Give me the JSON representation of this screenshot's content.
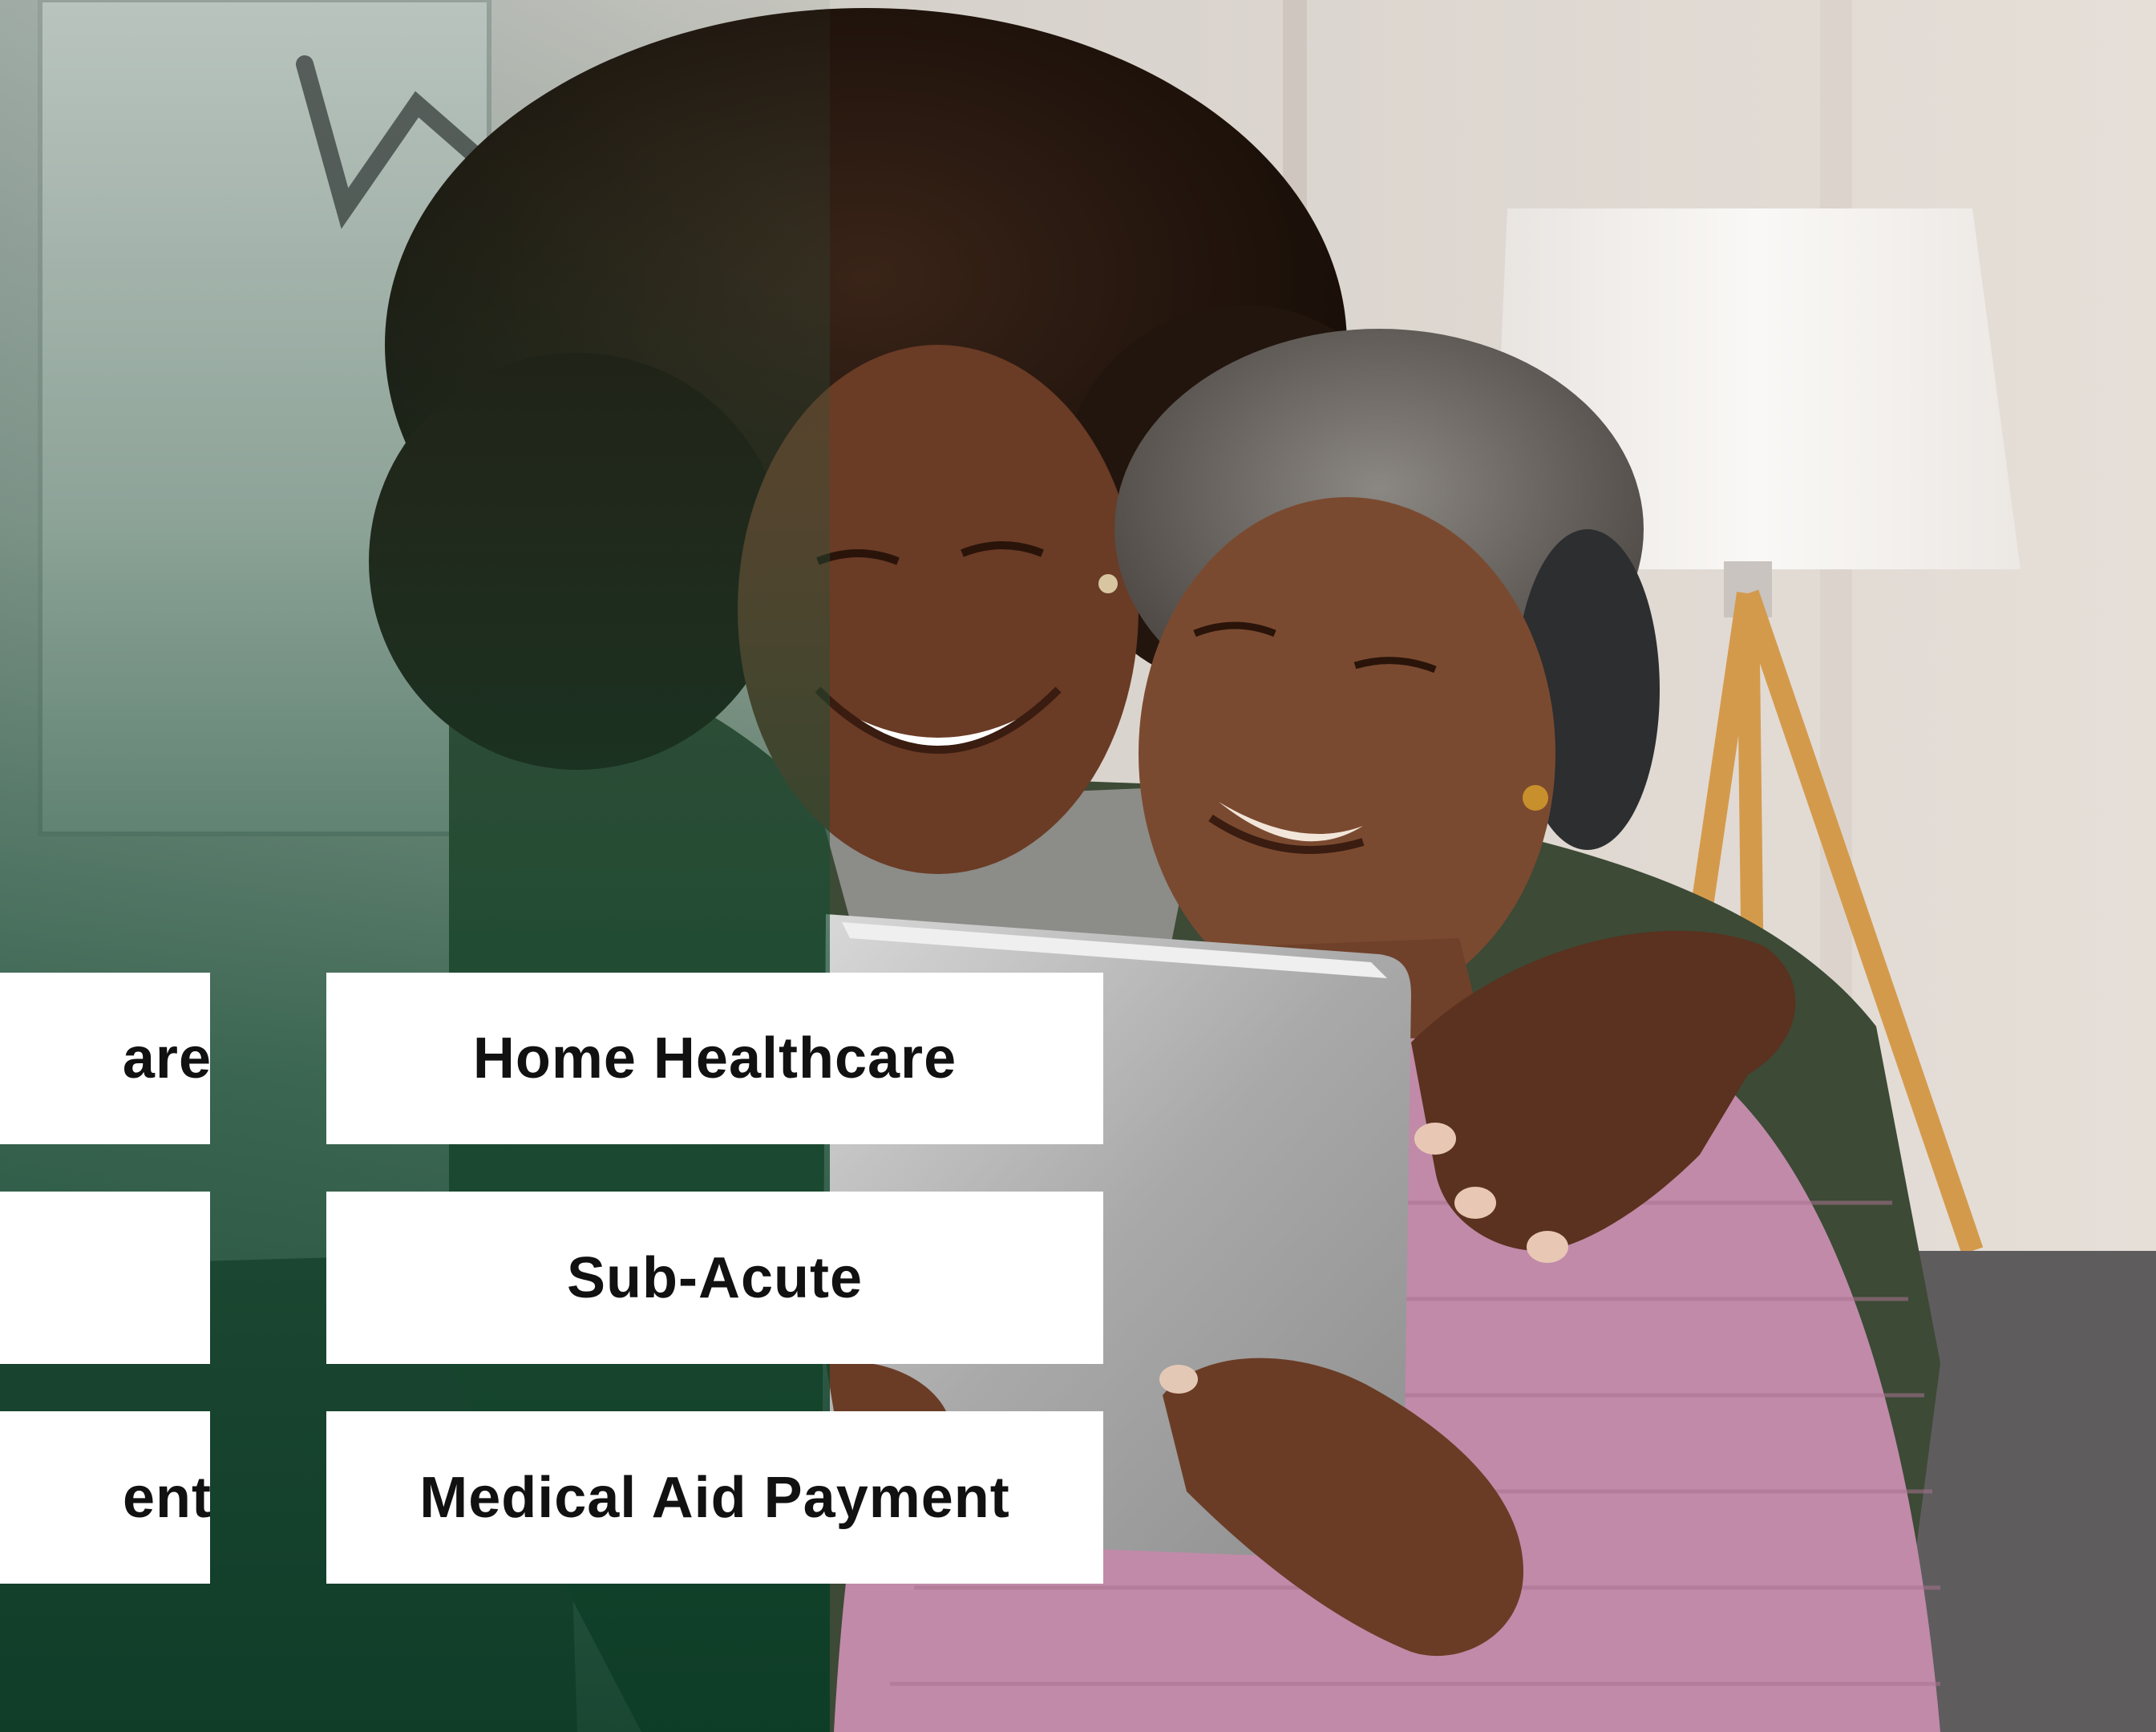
{
  "colors": {
    "overlay_green": "#0f4a32",
    "button_background": "#ffffff",
    "button_text": "#111111",
    "cardigan_green": "#3c4a36",
    "sweater_pink": "#c18aa9",
    "lamp_shade": "#f4f1ee",
    "sofa_gray": "#5f5c5e"
  },
  "left_column": {
    "buttons": [
      {
        "label": "are"
      },
      {
        "label": ""
      },
      {
        "label": "ent"
      }
    ]
  },
  "right_column": {
    "buttons": [
      {
        "label": "Home Healthcare"
      },
      {
        "label": "Sub-Acute"
      },
      {
        "label": "Medical Aid Payment"
      }
    ]
  }
}
